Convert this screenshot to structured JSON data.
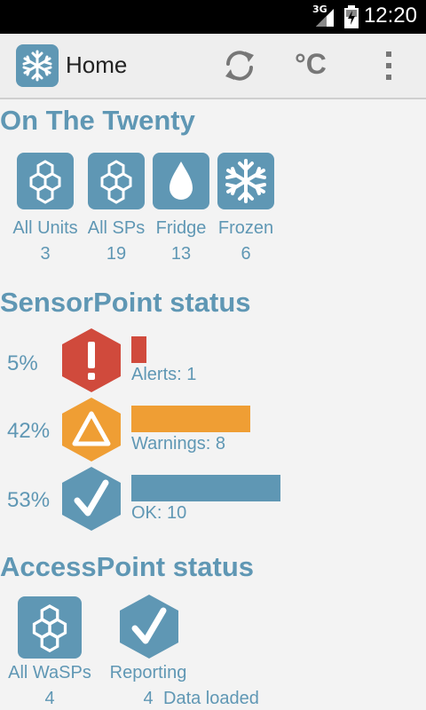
{
  "status_bar": {
    "network": "3G",
    "time": "12:20"
  },
  "action_bar": {
    "title": "Home",
    "temp_unit": "°C",
    "icons": [
      "snowflake-icon",
      "refresh-icon",
      "overflow-menu-icon"
    ]
  },
  "location": {
    "title": "On The Twenty",
    "tiles": [
      {
        "label": "All Units",
        "count": "3",
        "icon": "honeycomb-icon"
      },
      {
        "label": "All SPs",
        "count": "19",
        "icon": "honeycomb-icon"
      },
      {
        "label": "Fridge",
        "count": "13",
        "icon": "water-drop-icon"
      },
      {
        "label": "Frozen",
        "count": "6",
        "icon": "snowflake-icon"
      }
    ]
  },
  "sensorpoint_status": {
    "title": "SensorPoint status",
    "rows": [
      {
        "percent": "5%",
        "label": "Alerts: 1",
        "value": 1,
        "color": "#d04a3c",
        "icon": "alert-exclamation-icon"
      },
      {
        "percent": "42%",
        "label": "Warnings: 8",
        "value": 8,
        "color": "#ef9e34",
        "icon": "warning-triangle-icon"
      },
      {
        "percent": "53%",
        "label": "OK: 10",
        "value": 10,
        "color": "#5f97b4",
        "icon": "check-icon"
      }
    ],
    "bar_max": 10
  },
  "accesspoint_status": {
    "title": "AccessPoint status",
    "tiles": [
      {
        "label": "All WaSPs",
        "count": "4",
        "icon": "honeycomb-icon"
      },
      {
        "label": "Reporting",
        "count": "4",
        "icon": "check-icon"
      }
    ]
  },
  "footer": {
    "message": "Data loaded"
  },
  "colors": {
    "accent": "#5f97b4",
    "alert": "#d04a3c",
    "warning": "#ef9e34"
  }
}
